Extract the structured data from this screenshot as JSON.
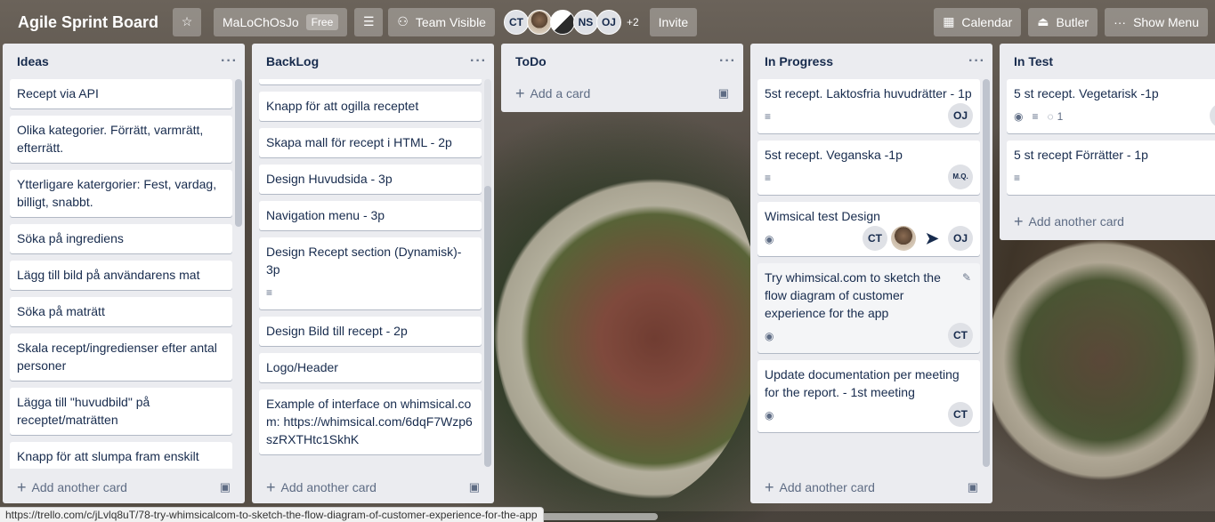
{
  "header": {
    "board_title": "Agile Sprint Board",
    "star_icon": "☆",
    "team_name": "MaLoChOsJo",
    "team_plan": "Free",
    "visibility": "Team Visible",
    "members": [
      "CT",
      "",
      "",
      "NS",
      "OJ"
    ],
    "more_members": "+2",
    "invite": "Invite",
    "calendar": "Calendar",
    "butler": "Butler",
    "show_menu": "Show Menu"
  },
  "lists": {
    "ideas": {
      "title": "Ideas",
      "cards": [
        "Recept via API",
        "Olika kategorier. Förrätt, varmrätt, efterrätt.",
        "Ytterligare katergorier: Fest, vardag, billigt, snabbt.",
        "Söka på ingrediens",
        "Lägg till bild på användarens mat",
        "Söka på maträtt",
        "Skala recept/ingredienser efter antal personer",
        "Lägga till \"huvudbild\" på receptet/maträtten",
        "Knapp för att slumpa fram enskilt recept"
      ],
      "footer": "Add another card"
    },
    "backlog": {
      "title": "BackLog",
      "cards": [
        "Knapp för att ogilla receptet",
        "Skapa mall för recept i HTML - 2p",
        "Design Huvudsida - 3p",
        "Navigation menu - 3p",
        "Design Recept section (Dynamisk)- 3p",
        "Design Bild till recept - 2p",
        "Logo/Header",
        "Example of interface on whimsical.com: https://whimsical.com/6dqF7Wzp6szRXTHtc1SkhK"
      ],
      "footer": "Add another card"
    },
    "todo": {
      "title": "ToDo",
      "footer": "Add a card"
    },
    "inprogress": {
      "title": "In Progress",
      "cards": [
        {
          "text": "5st recept. Laktosfria huvudrätter - 1p",
          "members": [
            "OJ"
          ]
        },
        {
          "text": "5st recept. Veganska -1p",
          "members": [
            "M.Q."
          ]
        },
        {
          "text": "Wimsical test Design",
          "members": [
            "CT",
            "",
            "",
            "OJ"
          ]
        },
        {
          "text": "Try whimsical.com to sketch the flow diagram of customer experience for the app",
          "members": [
            "CT"
          ]
        },
        {
          "text": "Update documentation per meeting for the report. - 1st meeting",
          "members": [
            "CT"
          ]
        }
      ],
      "footer": "Add another card"
    },
    "intest": {
      "title": "In Test",
      "cards": [
        {
          "text": "5 st recept. Vegetarisk -1p",
          "comments": "1",
          "members": [
            "C"
          ]
        },
        {
          "text": "5 st recept Förrätter - 1p",
          "members": [
            ""
          ]
        }
      ],
      "footer": "Add another card"
    }
  },
  "status_url": "https://trello.com/c/jLvlq8uT/78-try-whimsicalcom-to-sketch-the-flow-diagram-of-customer-experience-for-the-app"
}
